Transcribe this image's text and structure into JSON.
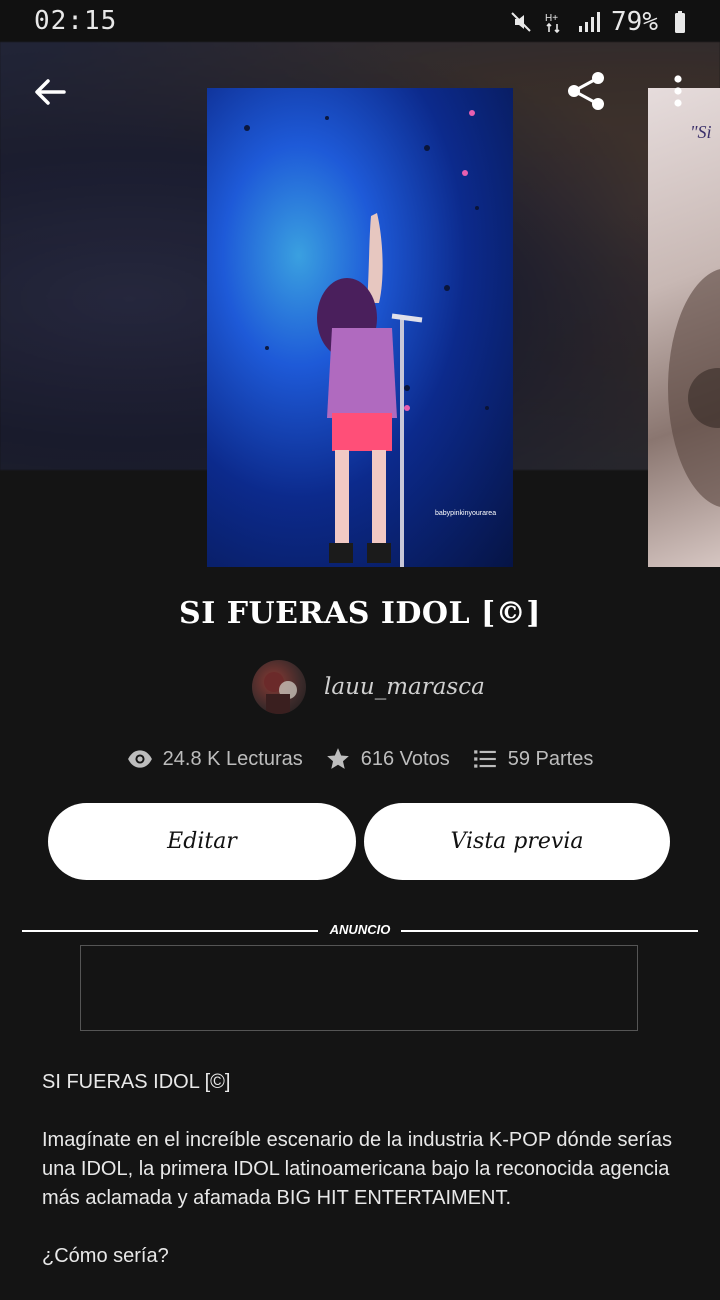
{
  "status_bar": {
    "time": "02:15",
    "battery": "79%"
  },
  "hero": {
    "cover_watermark": "babypinkinyourarea",
    "side_cover_text": "\"Si"
  },
  "book": {
    "title": "SI FUERAS IDOL [©]",
    "author": "lauu_marasca",
    "stats": {
      "reads": "24.8 K Lecturas",
      "votes": "616 Votos",
      "parts": "59 Partes"
    }
  },
  "actions": {
    "edit_label": "Editar",
    "preview_label": "Vista previa"
  },
  "ad": {
    "label": "ANUNCIO"
  },
  "description": {
    "p1": "SI FUERAS IDOL [©]",
    "p2": "Imagínate en el increíble escenario de la industria K-POP dónde serías una IDOL, la primera IDOL latinoamericana bajo la reconocida agencia más aclamada y afamada BIG HIT ENTERTAIMENT.",
    "p3": "¿Cómo sería?"
  },
  "icons": {
    "back": "arrow-left-icon",
    "share": "share-icon",
    "more": "more-vert-icon",
    "reads": "eye-icon",
    "votes": "star-icon",
    "parts": "list-icon"
  },
  "colors": {
    "background": "#141414",
    "button_bg": "#ffffff",
    "text": "#e6e6e6"
  }
}
